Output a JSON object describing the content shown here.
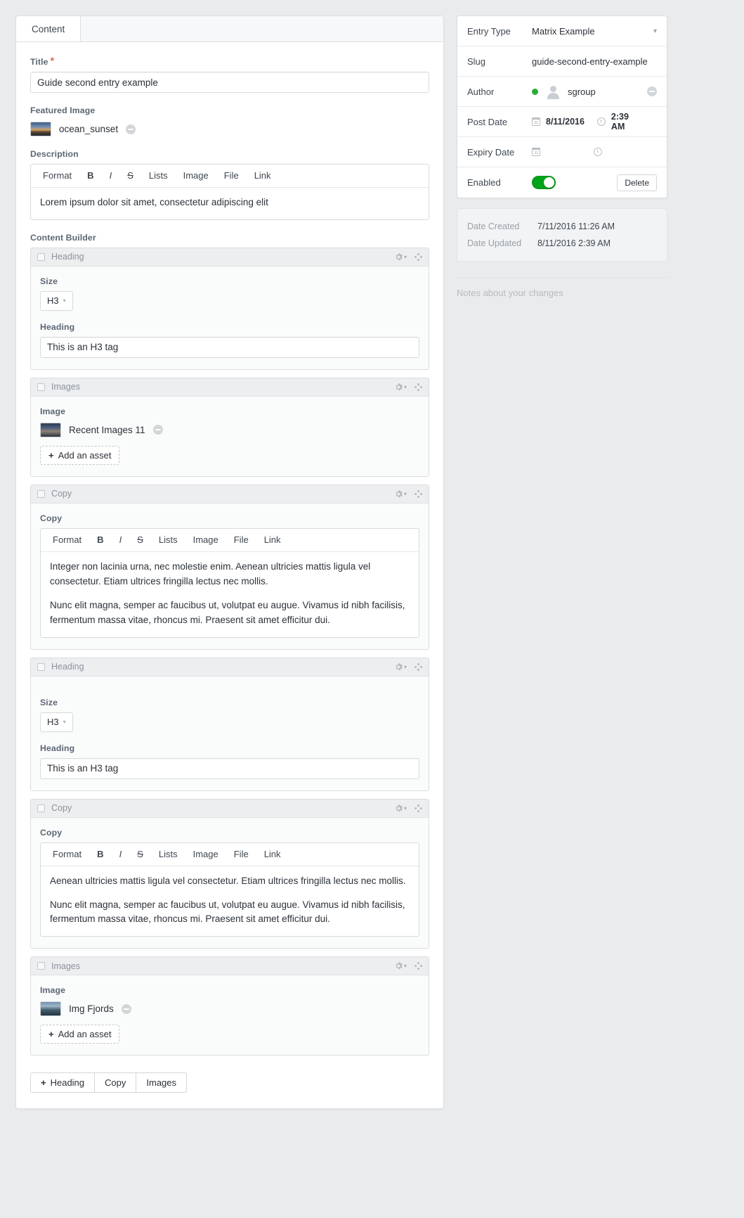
{
  "tabs": [
    {
      "label": "Content",
      "active": true
    }
  ],
  "fields": {
    "title": {
      "label": "Title",
      "required_marker": "*",
      "value": "Guide second entry example"
    },
    "featured_image": {
      "label": "Featured Image",
      "asset_name": "ocean_sunset",
      "remove_icon": "minus-circle-icon"
    },
    "description": {
      "label": "Description",
      "toolbar": [
        "Format",
        "B",
        "I",
        "S",
        "Lists",
        "Image",
        "File",
        "Link"
      ],
      "body": [
        "Lorem ipsum dolor sit amet, consectetur adipiscing elit"
      ]
    },
    "content_builder": {
      "label": "Content Builder"
    }
  },
  "blocks": [
    {
      "type": "Heading",
      "size_label": "Size",
      "size_value": "H3",
      "heading_label": "Heading",
      "heading_value": "This is an H3 tag"
    },
    {
      "type": "Images",
      "image_label": "Image",
      "asset_name": "Recent Images 11",
      "add_asset_label": "Add an asset"
    },
    {
      "type": "Copy",
      "copy_label": "Copy",
      "toolbar": [
        "Format",
        "B",
        "I",
        "S",
        "Lists",
        "Image",
        "File",
        "Link"
      ],
      "body": [
        "Integer non lacinia urna, nec molestie enim. Aenean ultricies mattis ligula vel consectetur. Etiam ultrices fringilla lectus nec mollis.",
        "Nunc elit magna, semper ac faucibus ut, volutpat eu augue. Vivamus id nibh facilisis, fermentum massa vitae, rhoncus mi. Praesent sit amet efficitur dui."
      ]
    },
    {
      "type": "Heading",
      "size_label": "Size",
      "size_value": "H3",
      "heading_label": "Heading",
      "heading_value": "This is an H3 tag"
    },
    {
      "type": "Copy",
      "copy_label": "Copy",
      "toolbar": [
        "Format",
        "B",
        "I",
        "S",
        "Lists",
        "Image",
        "File",
        "Link"
      ],
      "body": [
        "Aenean ultricies mattis ligula vel consectetur. Etiam ultrices fringilla lectus nec mollis.",
        "Nunc elit magna, semper ac faucibus ut, volutpat eu augue. Vivamus id nibh facilisis, fermentum massa vitae, rhoncus mi. Praesent sit amet efficitur dui."
      ]
    },
    {
      "type": "Images",
      "image_label": "Image",
      "asset_name": "Img Fjords",
      "add_asset_label": "Add an asset"
    }
  ],
  "add_block_buttons": [
    {
      "label": "Heading",
      "icon": "plus-icon"
    },
    {
      "label": "Copy"
    },
    {
      "label": "Images"
    }
  ],
  "sidebar": {
    "meta": {
      "entry_type": {
        "label": "Entry Type",
        "value": "Matrix Example"
      },
      "slug": {
        "label": "Slug",
        "value": "guide-second-entry-example"
      },
      "author": {
        "label": "Author",
        "value": "sgroup",
        "status_color": "#27ae38"
      },
      "post_date": {
        "label": "Post Date",
        "date": "8/11/2016",
        "time": "2:39 AM"
      },
      "expiry_date": {
        "label": "Expiry Date",
        "date": "",
        "time": ""
      },
      "enabled": {
        "label": "Enabled",
        "state": "on",
        "delete_label": "Delete"
      }
    },
    "dates": {
      "created": {
        "label": "Date Created",
        "value": "7/11/2016 11:26 AM"
      },
      "updated": {
        "label": "Date Updated",
        "value": "8/11/2016 2:39 AM"
      }
    },
    "notes_placeholder": "Notes about your changes"
  },
  "colors": {
    "accent_green": "#00a31a",
    "required_red": "#e5614f",
    "page_bg": "#e9ebed"
  }
}
